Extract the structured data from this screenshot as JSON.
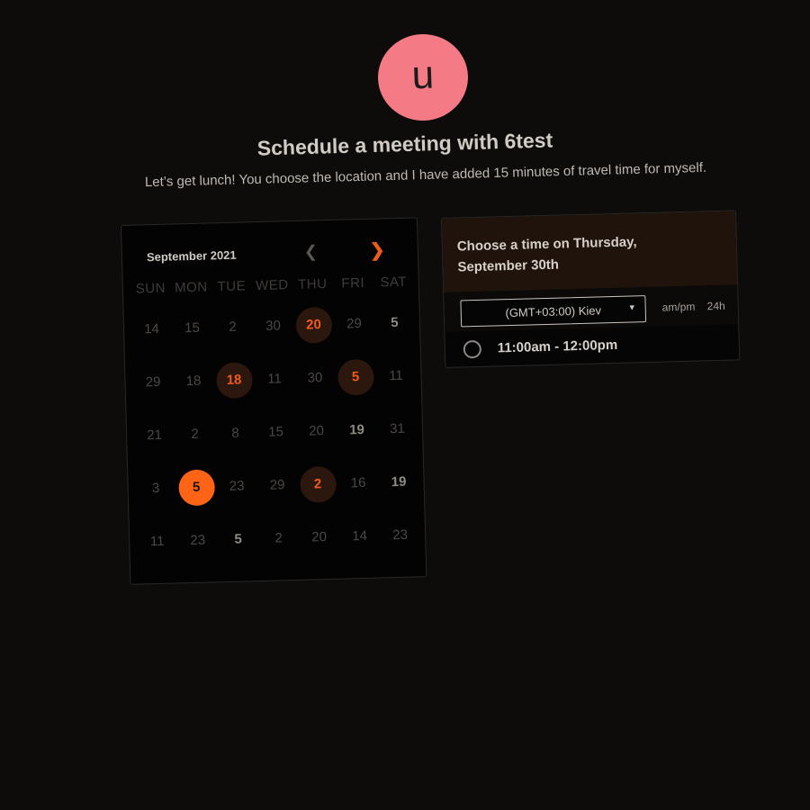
{
  "avatar": {
    "initial": "u",
    "color": "#f47a85"
  },
  "header": {
    "title": "Schedule a meeting with 6test",
    "subtitle": "Let’s get lunch! You choose the location and I have added 15 minutes of travel time for myself."
  },
  "calendar": {
    "month_label": "September 2021",
    "prev_icon": "chevron-left-icon",
    "next_icon": "chevron-right-icon",
    "weekdays": [
      "SUN",
      "MON",
      "TUE",
      "WED",
      "THU",
      "FRI",
      "SAT"
    ],
    "weeks": [
      [
        {
          "d": "14",
          "s": "muted"
        },
        {
          "d": "15",
          "s": "muted"
        },
        {
          "d": "2",
          "s": "muted"
        },
        {
          "d": "30",
          "s": "muted"
        },
        {
          "d": "20",
          "s": "avail"
        },
        {
          "d": "29",
          "s": "muted"
        },
        {
          "d": "5",
          "s": "plain"
        }
      ],
      [
        {
          "d": "29",
          "s": "muted"
        },
        {
          "d": "18",
          "s": "muted"
        },
        {
          "d": "18",
          "s": "avail"
        },
        {
          "d": "11",
          "s": "muted"
        },
        {
          "d": "30",
          "s": "muted"
        },
        {
          "d": "5",
          "s": "avail"
        },
        {
          "d": "11",
          "s": "muted"
        }
      ],
      [
        {
          "d": "21",
          "s": "muted"
        },
        {
          "d": "2",
          "s": "muted"
        },
        {
          "d": "8",
          "s": "muted"
        },
        {
          "d": "15",
          "s": "muted"
        },
        {
          "d": "20",
          "s": "muted"
        },
        {
          "d": "19",
          "s": "plain"
        },
        {
          "d": "31",
          "s": "muted"
        }
      ],
      [
        {
          "d": "3",
          "s": "muted"
        },
        {
          "d": "5",
          "s": "selected"
        },
        {
          "d": "23",
          "s": "muted"
        },
        {
          "d": "29",
          "s": "muted"
        },
        {
          "d": "2",
          "s": "avail"
        },
        {
          "d": "16",
          "s": "muted"
        },
        {
          "d": "19",
          "s": "plain"
        }
      ],
      [
        {
          "d": "11",
          "s": "muted"
        },
        {
          "d": "23",
          "s": "muted"
        },
        {
          "d": "5",
          "s": "plain"
        },
        {
          "d": "2",
          "s": "muted"
        },
        {
          "d": "20",
          "s": "muted"
        },
        {
          "d": "14",
          "s": "muted"
        },
        {
          "d": "23",
          "s": "muted"
        }
      ]
    ]
  },
  "time_panel": {
    "title": "Choose a time on Thursday, September 30th",
    "timezone": "(GMT+03:00) Kiev",
    "format_ampm": "am/pm",
    "format_24h": "24h",
    "slots": [
      "11:00am - 12:00pm"
    ]
  },
  "colors": {
    "background": "#0d0c0a",
    "accent": "#ff6416",
    "available_bg": "#2b170d"
  }
}
